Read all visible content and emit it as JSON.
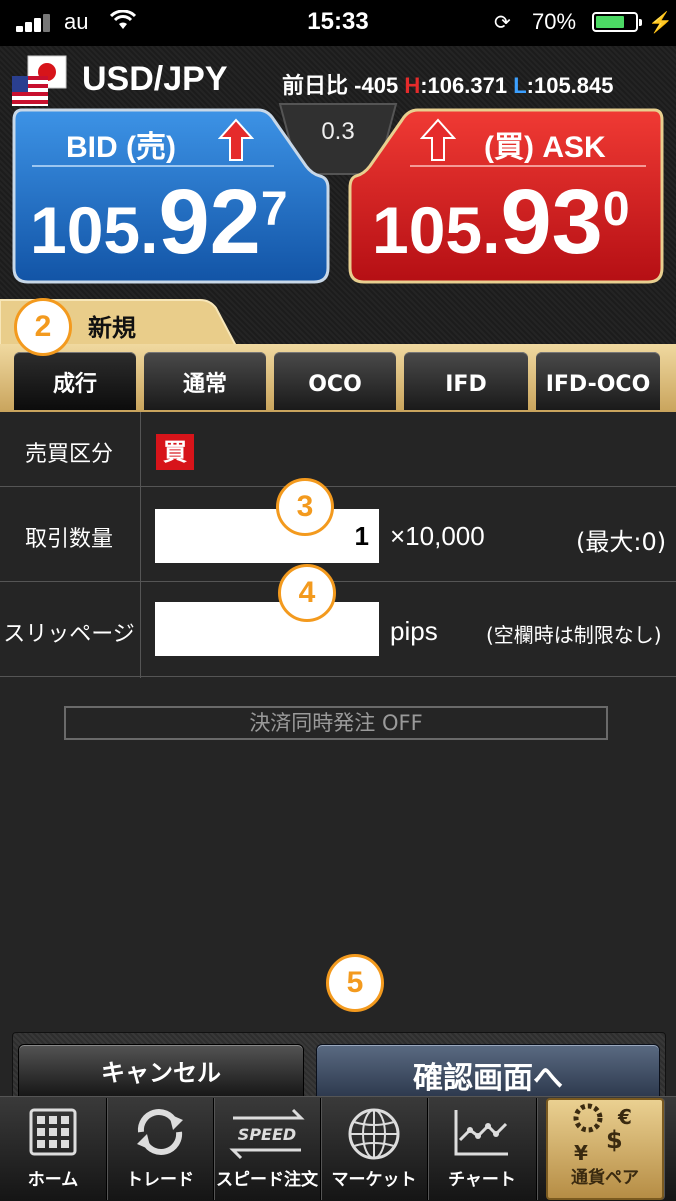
{
  "status_bar": {
    "carrier": "au",
    "time": "15:33",
    "battery_percent": "70%",
    "battery_level": 0.7
  },
  "header": {
    "pair": "USD/JPY",
    "prev_day_label": "前日比",
    "prev_day_change": "-405",
    "high_label": "H",
    "high_value": ":106.371",
    "low_label": "L",
    "low_value": ":105.845"
  },
  "bid": {
    "label": "BID (売)",
    "rate_big": "105.",
    "rate_mid": "92",
    "rate_small": "7",
    "arrow": "arrow-up-icon"
  },
  "ask": {
    "label": "(買) ASK",
    "rate_big": "105.",
    "rate_mid": "93",
    "rate_small": "0",
    "arrow": "arrow-up-icon"
  },
  "spread": "0.3",
  "order_tab": "新規",
  "order_types": [
    "成行",
    "通常",
    "OCO",
    "IFD",
    "IFD-OCO"
  ],
  "form": {
    "side_label": "売買区分",
    "side_value": "買",
    "quantity_label": "取引数量",
    "quantity_value": "1",
    "quantity_unit": "×10,000",
    "quantity_max": "(最大:0)",
    "slippage_label": "スリッページ",
    "slippage_value": "",
    "slippage_unit": "pips",
    "slippage_note": "(空欄時は制限なし)",
    "settle_toggle": "決済同時発注 OFF"
  },
  "callouts": [
    "2",
    "3",
    "4",
    "5"
  ],
  "actions": {
    "cancel": "キャンセル",
    "confirm": "確認画面へ"
  },
  "nav": {
    "items": [
      "ホーム",
      "トレード",
      "スピード注文",
      "マーケット",
      "チャート",
      "通貨ペア"
    ],
    "speed_icon_text": "SPEED"
  },
  "colors": {
    "bid_blue": "#1f6fc5",
    "ask_red": "#d7141a",
    "gold": "#d9b56a",
    "callout_orange": "#f39a1e"
  }
}
